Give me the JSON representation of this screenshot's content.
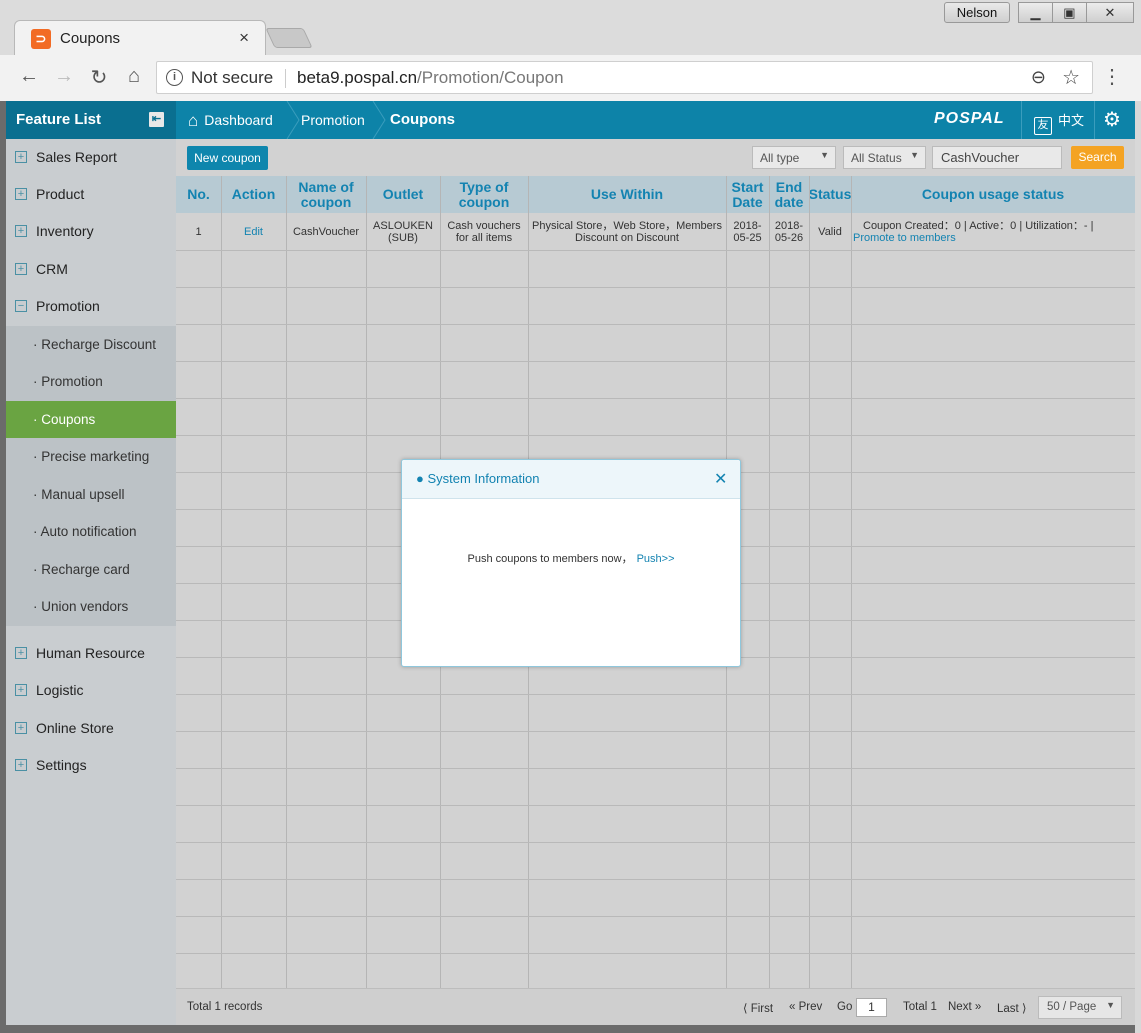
{
  "browser": {
    "tab_title": "Coupons",
    "tab_close": "×",
    "profile": "Nelson",
    "security": "Not secure",
    "url_host": "beta9.pospal.cn",
    "url_path": "/Promotion/Coupon",
    "icons": [
      "back-arrow-icon",
      "forward-arrow-icon",
      "reload-icon",
      "home-icon",
      "info-icon",
      "zoom-icon",
      "star-icon",
      "menu-icon"
    ]
  },
  "header": {
    "feature_list": "Feature List",
    "breadcrumbs": [
      "Dashboard",
      "Promotion",
      "Coupons"
    ],
    "logo": "POSPAL",
    "lang": "中文",
    "lang_glyph": "友"
  },
  "sidebar": {
    "items": [
      "Sales Report",
      "Product",
      "Inventory",
      "CRM",
      "Promotion"
    ],
    "promotion_sub": [
      "· Recharge Discount",
      "· Promotion",
      "· Coupons",
      "· Precise marketing",
      "· Manual upsell",
      "· Auto notification",
      "· Recharge card",
      "· Union vendors"
    ],
    "items_after": [
      "Human Resource",
      "Logistic",
      "Online Store",
      "Settings"
    ],
    "active_sub": "· Coupons",
    "colors": {
      "active": "#6aa442",
      "header": "#0d83a8"
    }
  },
  "toolbar": {
    "new_coupon": "New coupon",
    "type_filter": "All type",
    "status_filter": "All Status",
    "search_value": "CashVoucher",
    "search_button": "Search"
  },
  "table": {
    "headers": [
      "No.",
      "Action",
      "Name of coupon",
      "Outlet",
      "Type of coupon",
      "Use Within",
      "Start Date",
      "End date",
      "Status",
      "Coupon usage status"
    ],
    "rows": [
      {
        "no": "1",
        "action": "Edit",
        "name": "CashVoucher",
        "outlet": "ASLOUKEN (SUB)",
        "type": "Cash vouchers for all items",
        "use_within": "Physical Store，Web Store，Members Discount on Discount",
        "start": "2018-05-25",
        "end": "2018-05-26",
        "status": "Valid",
        "usage": "Coupon Created：0 | Active：0 | Utilization：- |",
        "usage_link": "Promote to members"
      }
    ]
  },
  "footer": {
    "total_records": "Total 1 records",
    "first": "First",
    "prev": "Prev",
    "go": "Go",
    "page": "1",
    "total": "Total 1",
    "next": "Next",
    "last": "Last",
    "per_page": "50 / Page"
  },
  "dialog": {
    "title": "System Information",
    "message": "Push coupons to members now，",
    "push_link": "Push>>"
  }
}
